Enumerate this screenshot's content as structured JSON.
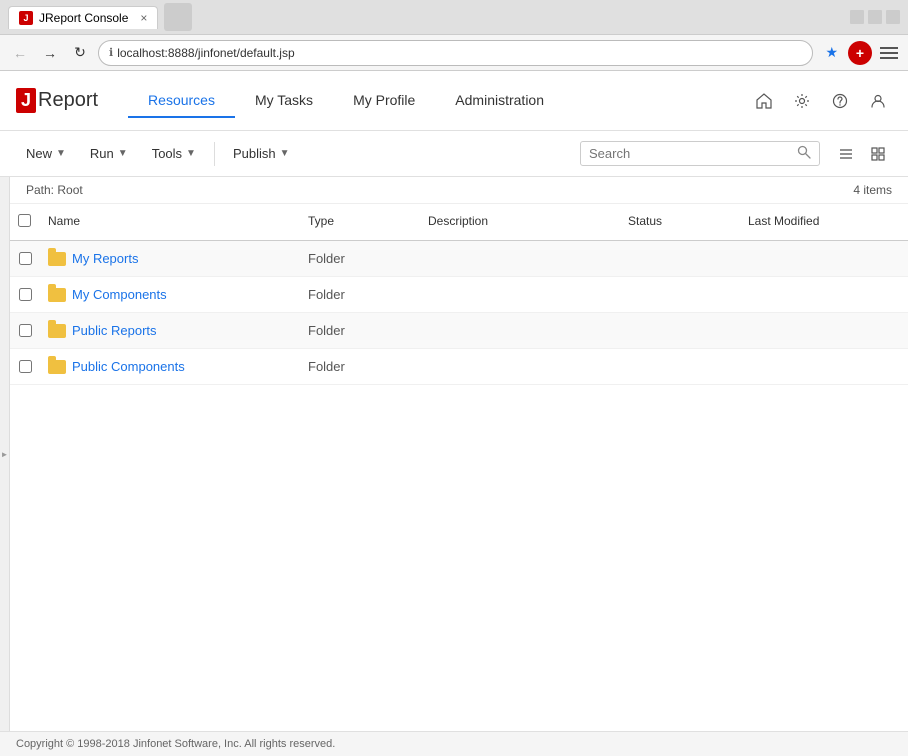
{
  "browser": {
    "tab_title": "JReport Console",
    "tab_close": "×",
    "address": "localhost:8888/jinfonet/default.jsp",
    "back_btn": "←",
    "forward_btn": "→",
    "refresh_btn": "↻"
  },
  "header": {
    "logo_j": "J",
    "logo_text": "Report",
    "nav_items": [
      {
        "label": "Resources",
        "active": true
      },
      {
        "label": "My Tasks",
        "active": false
      },
      {
        "label": "My Profile",
        "active": false
      },
      {
        "label": "Administration",
        "active": false
      }
    ]
  },
  "toolbar": {
    "new_label": "New",
    "run_label": "Run",
    "tools_label": "Tools",
    "publish_label": "Publish",
    "search_placeholder": "Search"
  },
  "path_bar": {
    "path": "Path: Root",
    "items_count": "4 items"
  },
  "table": {
    "headers": [
      "",
      "Name",
      "Type",
      "Description",
      "Status",
      "Last Modified"
    ],
    "rows": [
      {
        "name": "My Reports",
        "type": "Folder",
        "description": "",
        "status": "",
        "last_modified": ""
      },
      {
        "name": "My Components",
        "type": "Folder",
        "description": "",
        "status": "",
        "last_modified": ""
      },
      {
        "name": "Public Reports",
        "type": "Folder",
        "description": "",
        "status": "",
        "last_modified": ""
      },
      {
        "name": "Public Components",
        "type": "Folder",
        "description": "",
        "status": "",
        "last_modified": ""
      }
    ]
  },
  "footer": {
    "text": "Copyright © 1998-2018 Jinfonet Software, Inc. All rights reserved."
  }
}
